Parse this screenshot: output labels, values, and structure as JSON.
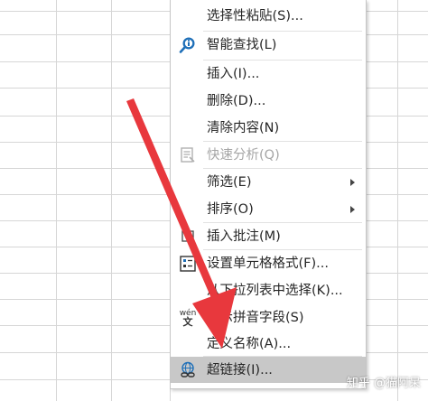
{
  "menu": {
    "items": [
      {
        "label": "选择性粘贴(S)...",
        "icon": "",
        "disabled": false,
        "submenu": false
      },
      {
        "label": "智能查找(L)",
        "icon": "smart-lookup-icon",
        "disabled": false,
        "submenu": false
      },
      {
        "label": "插入(I)...",
        "icon": "",
        "disabled": false,
        "submenu": false
      },
      {
        "label": "删除(D)...",
        "icon": "",
        "disabled": false,
        "submenu": false
      },
      {
        "label": "清除内容(N)",
        "icon": "",
        "disabled": false,
        "submenu": false
      },
      {
        "label": "快速分析(Q)",
        "icon": "quick-analysis-icon",
        "disabled": true,
        "submenu": false
      },
      {
        "label": "筛选(E)",
        "icon": "",
        "disabled": false,
        "submenu": true
      },
      {
        "label": "排序(O)",
        "icon": "",
        "disabled": false,
        "submenu": true
      },
      {
        "label": "插入批注(M)",
        "icon": "comment-icon",
        "disabled": false,
        "submenu": false
      },
      {
        "label": "设置单元格格式(F)...",
        "icon": "format-cells-icon",
        "disabled": false,
        "submenu": false
      },
      {
        "label": "从下拉列表中选择(K)...",
        "icon": "",
        "disabled": false,
        "submenu": false
      },
      {
        "label": "显示拼音字段(S)",
        "icon": "phonetic-icon",
        "disabled": false,
        "submenu": false
      },
      {
        "label": "定义名称(A)...",
        "icon": "",
        "disabled": false,
        "submenu": false
      },
      {
        "label": "超链接(I)...",
        "icon": "hyperlink-icon",
        "disabled": false,
        "submenu": false,
        "highlighted": true
      }
    ]
  },
  "phonetic_icon_text": {
    "top": "wén",
    "bottom": "文"
  },
  "watermark": "知乎 @猫阿呆",
  "colors": {
    "arrow": "#e8383d",
    "highlight": "#c8c8c8",
    "accent": "#1e6fb8"
  }
}
